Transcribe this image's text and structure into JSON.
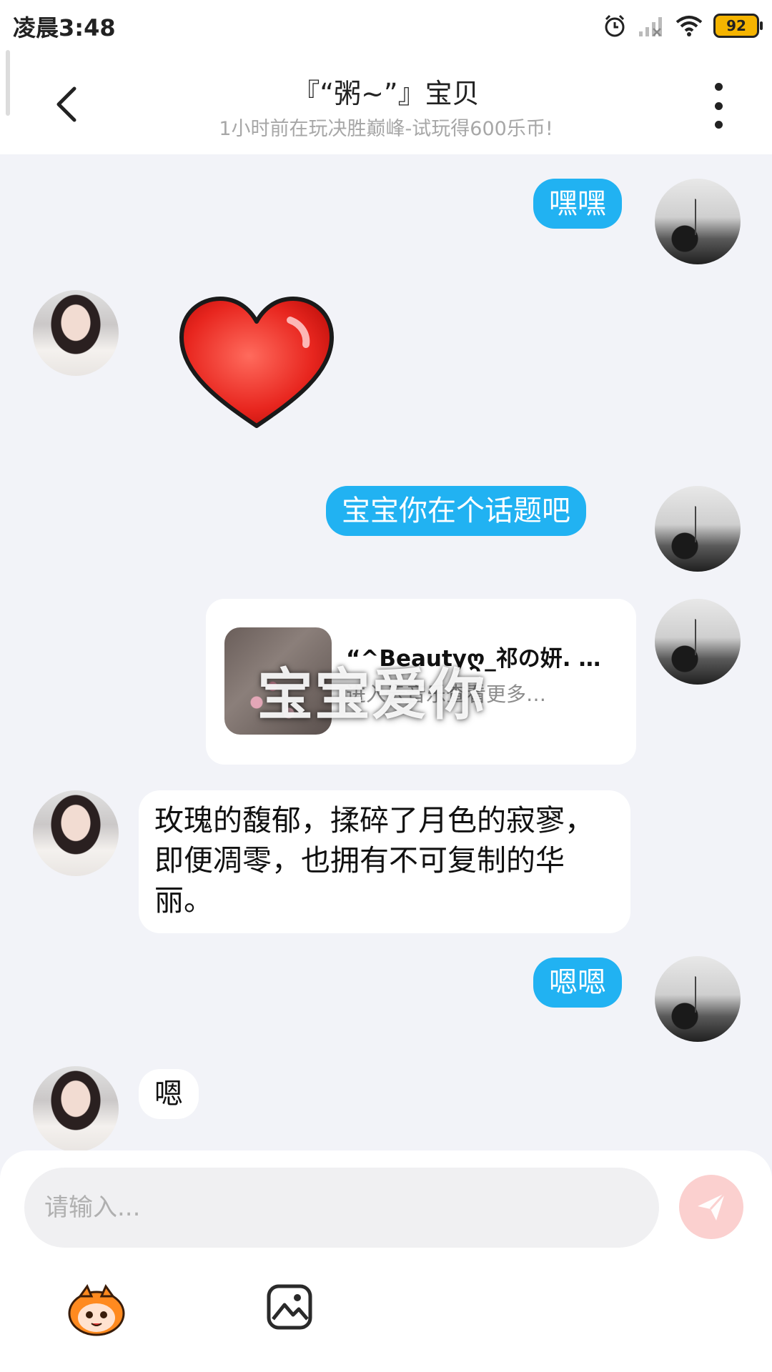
{
  "status_bar": {
    "time": "凌晨3:48",
    "battery": "92",
    "icons": [
      "alarm-icon",
      "signal-icon",
      "wifi-icon",
      "battery-icon"
    ]
  },
  "header": {
    "title": "『“粥~”』宝贝",
    "subtitle": "1小时前在玩决胜巅峰-试玩得600乐币!",
    "back_icon": "chevron-left-icon",
    "more_icon": "more-vertical-icon"
  },
  "messages": [
    {
      "side": "out",
      "type": "text",
      "text": "嘿嘿"
    },
    {
      "side": "in",
      "type": "sticker",
      "sticker": "heart-sticker"
    },
    {
      "side": "out",
      "type": "text",
      "text": "宝宝你在个话题吧"
    },
    {
      "side": "out",
      "type": "card",
      "title": "“^Beautyღ_祁の妍. …",
      "subtitle": "进入云音乐查看更多…"
    },
    {
      "side": "in",
      "type": "text",
      "text": "玫瑰的馥郁，揉碎了月色的寂寥，即便凋零，也拥有不可复制的华丽。"
    },
    {
      "side": "out",
      "type": "text",
      "text": "嗯嗯"
    },
    {
      "side": "in",
      "type": "text",
      "text": "嗯"
    }
  ],
  "overlay": {
    "watermark": "宝宝爱你"
  },
  "composer": {
    "placeholder": "请输入...",
    "send_icon": "send-icon",
    "tools": [
      "mascot-icon",
      "image-icon"
    ]
  },
  "colors": {
    "outgoing_bubble": "#21b2f2",
    "incoming_bubble": "#ffffff",
    "chat_background": "#f2f3f8",
    "send_button": "#fbd0cf"
  }
}
